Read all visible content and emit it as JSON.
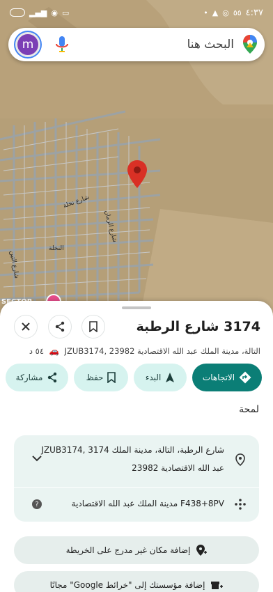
{
  "status_bar": {
    "time": "٤:٣٧",
    "right_info": "٥٥"
  },
  "search": {
    "placeholder": "البحث هنا",
    "avatar_letter": "m"
  },
  "map": {
    "street_labels": [
      "شارع نخلة",
      "شارع الرمان",
      "شارع التين",
      "النخلة"
    ],
    "sector_label": "SECTOR"
  },
  "place": {
    "title": "3174 شارع الرطبة",
    "subtitle": "التالة، مدينة الملك عبد الله الاقتصادية JZUB3174, 23982",
    "drive_time": "٥٤ د"
  },
  "actions": {
    "directions": "الاتجاهات",
    "start": "البدء",
    "save": "حفظ",
    "share": "مشاركة"
  },
  "section_label": "لمحة",
  "details": {
    "address_line1": "شارع الرطبة، التالة، مدينة الملك JZUB3174, 3174",
    "address_line2": "عبد الله الاقتصادية 23982",
    "plus_code": "F438+8PV مدينة الملك عبد الله الاقتصادية"
  },
  "add_place": "إضافة مكان غير مدرج على الخريطة",
  "add_business": "إضافة مؤسستك إلى \"خرائط Google\" مجانًا",
  "colors": {
    "accent": "#0b7e76",
    "accent_light": "#d6f3ef",
    "card": "#eaf4f2",
    "pin": "#d93025"
  }
}
